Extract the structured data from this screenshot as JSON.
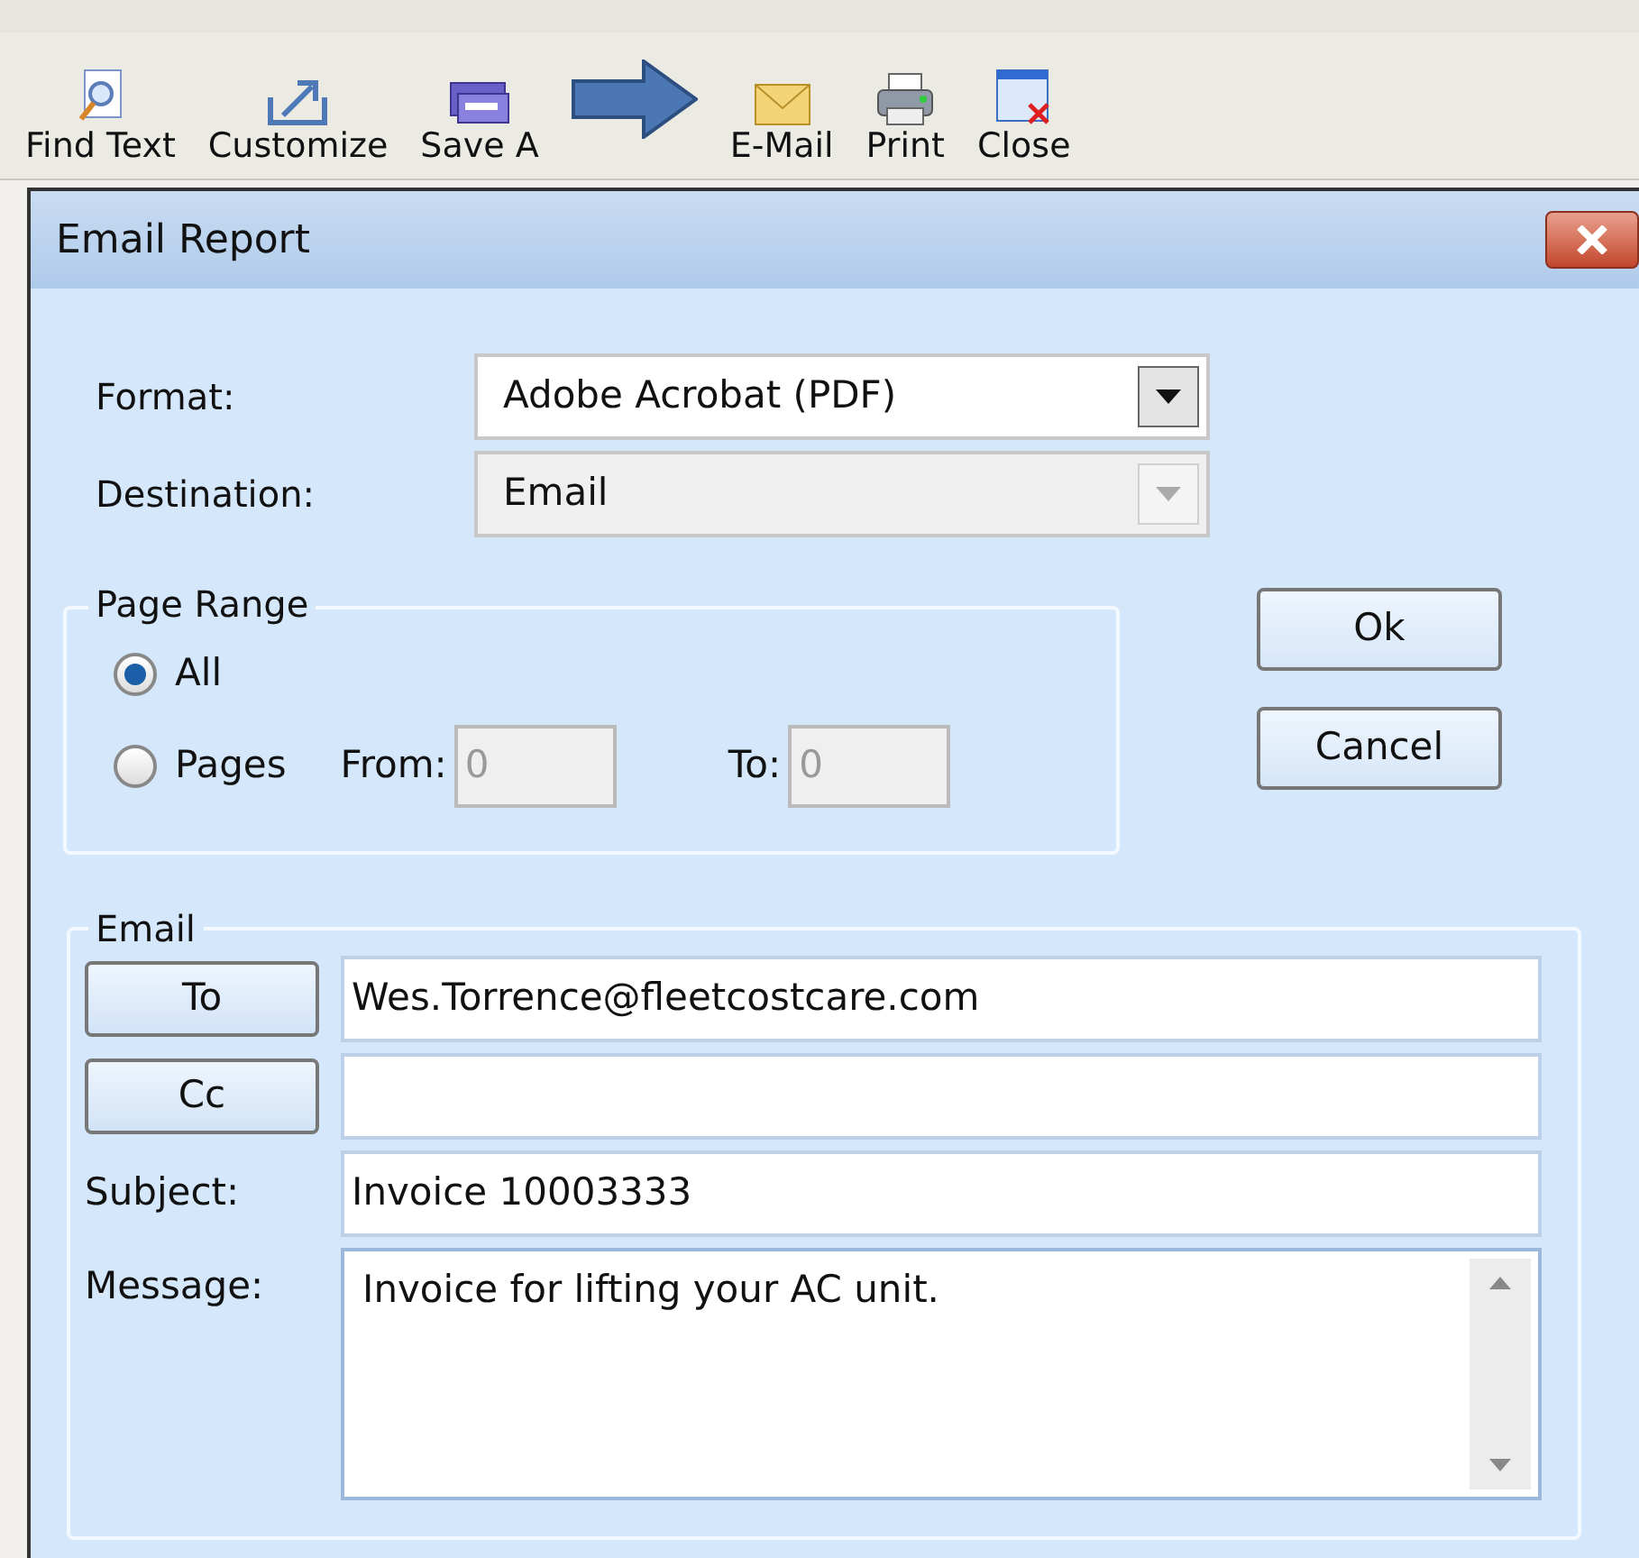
{
  "toolbar": [
    {
      "label": "Find Text"
    },
    {
      "label": "Customize"
    },
    {
      "label": "Save A"
    },
    {
      "label": "E-Mail"
    },
    {
      "label": "Print"
    },
    {
      "label": "Close"
    }
  ],
  "dialog": {
    "title": "Email Report",
    "format": {
      "label": "Format:",
      "value": "Adobe Acrobat (PDF)",
      "disabled": false
    },
    "destination": {
      "label": "Destination:",
      "value": "Email",
      "disabled": true
    },
    "page_range": {
      "title": "Page Range",
      "options": [
        {
          "label": "All",
          "selected": true
        },
        {
          "label": "Pages",
          "selected": false
        }
      ],
      "from": {
        "label": "From:",
        "value": "0"
      },
      "to": {
        "label": "To:",
        "value": "0"
      }
    },
    "buttons": [
      "Ok",
      "Cancel"
    ],
    "email": {
      "title": "Email",
      "to": {
        "button": "To",
        "value": "Wes.Torrence@fleetcostcare.com"
      },
      "cc": {
        "button": "Cc"
      },
      "subject": {
        "label": "Subject:",
        "value": "Invoice 10003333"
      },
      "message": {
        "label": "Message:",
        "value": "Invoice for lifting your AC unit."
      }
    }
  }
}
